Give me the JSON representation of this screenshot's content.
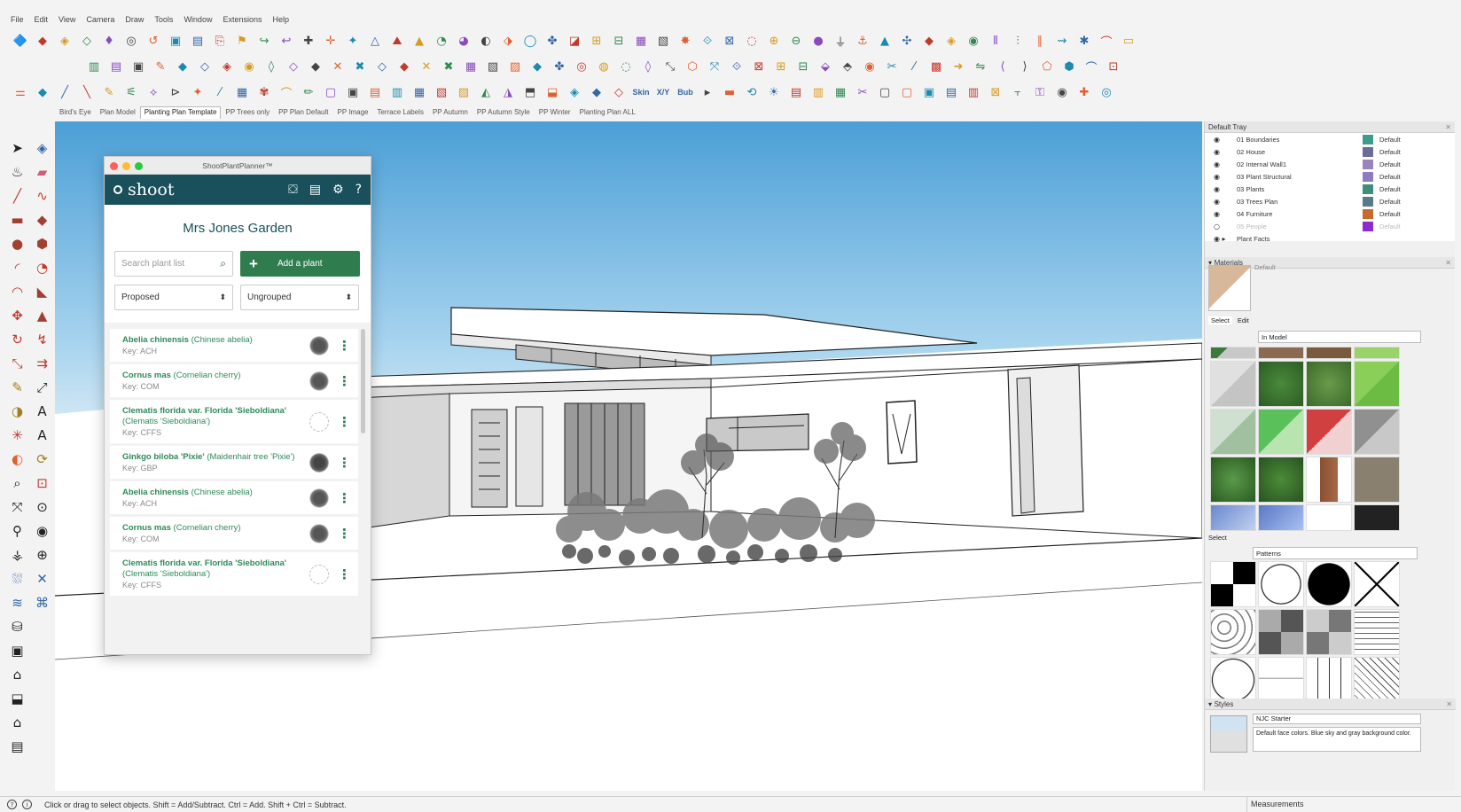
{
  "menu": [
    "File",
    "Edit",
    "View",
    "Camera",
    "Draw",
    "Tools",
    "Window",
    "Extensions",
    "Help"
  ],
  "scenes": {
    "active": "Planting Plan Template",
    "tabs": [
      "Bird's Eye",
      "Plan Model",
      "Planting Plan Template",
      "PP Trees only",
      "PP Plan Default",
      "PP Image",
      "Terrace Labels",
      "PP Autumn",
      "PP Autumn Style",
      "PP Winter",
      "Planting Plan ALL"
    ]
  },
  "toolbar_labels": {
    "skin": "Skin",
    "xy": "X/Y",
    "bub": "Bub"
  },
  "plugin": {
    "window_title": "ShootPlantPlanner™",
    "brand": "shoot",
    "garden_name": "Mrs Jones Garden",
    "search_placeholder": "Search plant list",
    "add_label": "Add a plant",
    "filter_status": "Proposed",
    "filter_group": "Ungrouped",
    "plants": [
      {
        "latin": "Abelia chinensis",
        "common": "(Chinese abelia)",
        "key": "Key: ACH",
        "symbol": "dark"
      },
      {
        "latin": "Cornus mas",
        "common": "(Cornelian cherry)",
        "key": "Key: COM",
        "symbol": "dark"
      },
      {
        "latin": "Clematis florida var. Florida 'Sieboldiana'",
        "common": "(Clematis 'Sieboldiana')",
        "key": "Key: CFFS",
        "symbol": "light"
      },
      {
        "latin": "Ginkgo biloba 'Pixie'",
        "common": "(Maidenhair tree 'Pixie')",
        "key": "Key: GBP",
        "symbol": "tree"
      },
      {
        "latin": "Abelia chinensis",
        "common": "(Chinese abelia)",
        "key": "Key: ACH",
        "symbol": "dark"
      },
      {
        "latin": "Cornus mas",
        "common": "(Cornelian cherry)",
        "key": "Key: COM",
        "symbol": "dark"
      },
      {
        "latin": "Clematis florida var. Florida 'Sieboldiana'",
        "common": "(Clematis 'Sieboldiana')",
        "key": "Key: CFFS",
        "symbol": "light"
      }
    ]
  },
  "tray": {
    "title": "Default Tray",
    "layers": [
      {
        "name": "01 Boundaries",
        "color": "#3a9e8a",
        "material": "Default",
        "visible": true
      },
      {
        "name": "02 House",
        "color": "#6c6c9a",
        "material": "Default",
        "visible": true
      },
      {
        "name": "02 Internal Wall1",
        "color": "#9a84c0",
        "material": "Default",
        "visible": true
      },
      {
        "name": "03 Plant Structural",
        "color": "#8c7cc4",
        "material": "Default",
        "visible": true
      },
      {
        "name": "03 Plants",
        "color": "#3e8f7a",
        "material": "Default",
        "visible": true
      },
      {
        "name": "03 Trees Plan",
        "color": "#5a7a8c",
        "material": "Default",
        "visible": true
      },
      {
        "name": "04 Furniture",
        "color": "#c86a2a",
        "material": "Default",
        "visible": true
      },
      {
        "name": "05 People",
        "color": "#8a2ad0",
        "material": "Default",
        "visible": false
      },
      {
        "name": "Plant Facts",
        "color": "#f0f0f0",
        "material": "",
        "visible": true
      }
    ],
    "materials_title": "Materials",
    "material_name": "Default",
    "mat_tab_select": "Select",
    "mat_tab_edit": "Edit",
    "in_model": "In Model",
    "select_label": "Select",
    "patterns": "Patterns",
    "styles_title": "Styles",
    "style_name": "NJC Starter",
    "style_desc": "Default face colors. Blue sky and gray background color."
  },
  "status": {
    "hint": "Click or drag to select objects. Shift = Add/Subtract. Ctrl = Add. Shift + Ctrl = Subtract.",
    "measurements_label": "Measurements"
  }
}
